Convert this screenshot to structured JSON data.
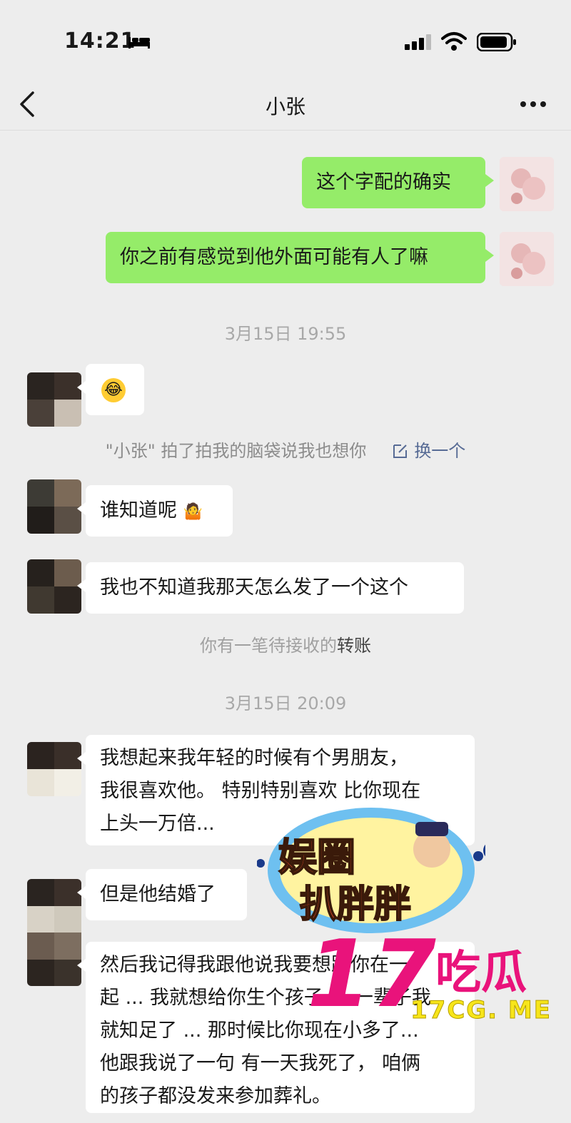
{
  "status_bar": {
    "time": "14:21"
  },
  "nav": {
    "title": "小张"
  },
  "messages": {
    "m1": "这个字配的确实",
    "m2": "你之前有感觉到他外面可能有人了嘛",
    "ts1": "3月15日 19:55",
    "pat_text": "\"小张\" 拍了拍我的脑袋说我也想你",
    "pat_action": "换一个",
    "m3": "谁知道呢",
    "m4": "我也不知道我那天怎么发了一个这个",
    "transfer_prefix": "你有一笔待接收的",
    "transfer_link": "转账",
    "ts2": "3月15日 20:09",
    "m5_lines": [
      "我想起来我年轻的时候有个男朋友，",
      "我很喜欢他。 特别特别喜欢 比你现在",
      "上头一万倍..."
    ],
    "m6": "但是他结婚了",
    "m7_lines": [
      "然后我记得我跟他说我要想跟你在一",
      "起 ... 我就想给你生个孩子 ... 一辈子我",
      "就知足了 ... 那时候比你现在小多了...",
      "他跟我说了一句 有一天我死了， 咱俩",
      "的孩子都没发来参加葬礼。"
    ]
  },
  "watermark": {
    "number": "17",
    "name": "吃瓜",
    "url": "17CG. ME",
    "badge": "娱圈扒胖胖"
  }
}
